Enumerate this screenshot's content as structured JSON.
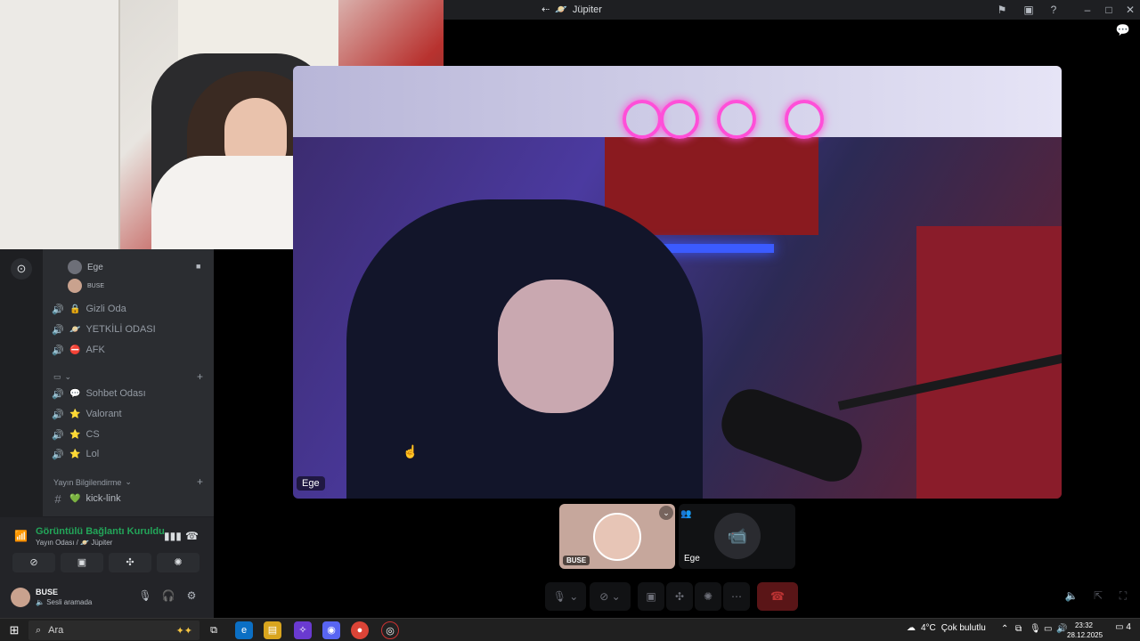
{
  "titlebar": {
    "title": "Jüpiter",
    "title_emoji": "🪐"
  },
  "sidebar": {
    "connected_users": [
      {
        "name": "Ege"
      },
      {
        "name": "BUSE"
      }
    ],
    "channels_group1": [
      {
        "name": "Gizli Oda",
        "emoji": "🔒"
      },
      {
        "name": "YETKİLİ ODASI",
        "emoji": "🪐"
      },
      {
        "name": "AFK",
        "emoji": "⛔"
      }
    ],
    "channels_group2": [
      {
        "name": "Sohbet Odası",
        "emoji": "💬"
      },
      {
        "name": "Valorant",
        "emoji": "⭐"
      },
      {
        "name": "CS",
        "emoji": "⭐"
      },
      {
        "name": "Lol",
        "emoji": "⭐"
      }
    ],
    "category_stream": "Yayın Bilgilendirme",
    "text_channel": {
      "name": "kick-link",
      "emoji": "💚"
    }
  },
  "voice": {
    "status": "Görüntülü Bağlantı Kuruldu",
    "sub_channel": "Yayın Odası /",
    "sub_server": "Jüpiter"
  },
  "user": {
    "name": "BUSE",
    "state": "Sesli aramada"
  },
  "main_video": {
    "label": "Ege"
  },
  "thumbnails": [
    {
      "label": "BUSE"
    },
    {
      "label": "Ege"
    }
  ],
  "taskbar": {
    "search_placeholder": "Ara",
    "weather_temp": "4°C",
    "weather_text": "Çok bulutlu",
    "time": "23:32",
    "date": "28.12.2025",
    "notifications": "4"
  }
}
